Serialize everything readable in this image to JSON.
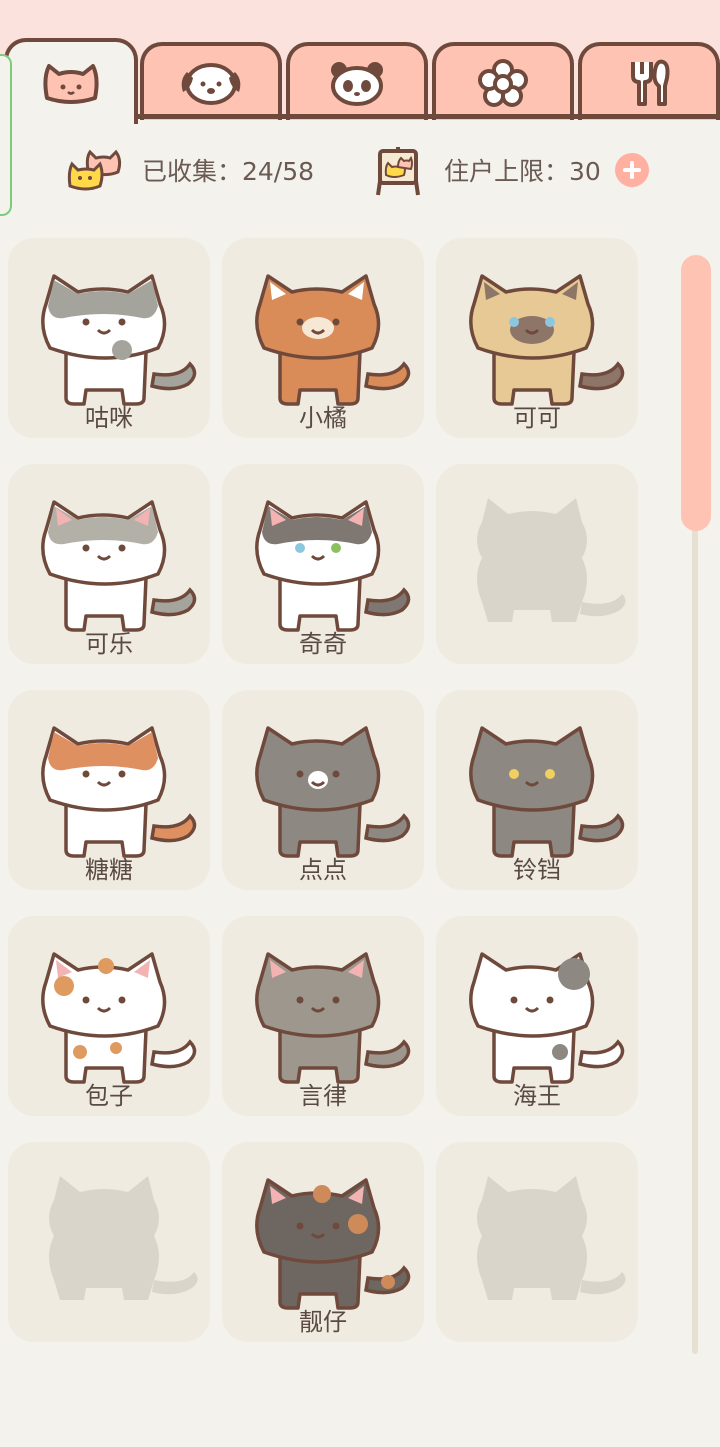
{
  "tabs": [
    {
      "icon": "cat-face-icon",
      "active": true
    },
    {
      "icon": "dog-face-icon",
      "active": false
    },
    {
      "icon": "panda-face-icon",
      "active": false
    },
    {
      "icon": "flower-icon",
      "active": false
    },
    {
      "icon": "fork-spoon-icon",
      "active": false
    }
  ],
  "stats": {
    "collected_label": "已收集：24/58",
    "resident_label": "住户上限：30"
  },
  "colors": {
    "accent": "#ffc3b4",
    "outline": "#6f4a3c",
    "card": "#f0ebe1",
    "background": "#f4f2ec"
  },
  "cats": [
    {
      "name": "咕咪",
      "pattern": "grey-white",
      "unlocked": true
    },
    {
      "name": "小橘",
      "pattern": "orange-tabby",
      "unlocked": true
    },
    {
      "name": "可可",
      "pattern": "siamese",
      "unlocked": true
    },
    {
      "name": "可乐",
      "pattern": "grey-tabby-white",
      "unlocked": true
    },
    {
      "name": "奇奇",
      "pattern": "odd-eye-white",
      "unlocked": true
    },
    {
      "name": "",
      "pattern": "silhouette",
      "unlocked": false
    },
    {
      "name": "糖糖",
      "pattern": "orange-white",
      "unlocked": true
    },
    {
      "name": "点点",
      "pattern": "grey-spot",
      "unlocked": true
    },
    {
      "name": "铃铛",
      "pattern": "grey-yellow-eyes",
      "unlocked": true
    },
    {
      "name": "包子",
      "pattern": "calico-spots",
      "unlocked": true
    },
    {
      "name": "言律",
      "pattern": "grey-tabby",
      "unlocked": true
    },
    {
      "name": "海王",
      "pattern": "white-patch",
      "unlocked": true
    },
    {
      "name": "",
      "pattern": "silhouette",
      "unlocked": false
    },
    {
      "name": "靓仔",
      "pattern": "tortoiseshell",
      "unlocked": true
    },
    {
      "name": "",
      "pattern": "silhouette",
      "unlocked": false
    }
  ]
}
